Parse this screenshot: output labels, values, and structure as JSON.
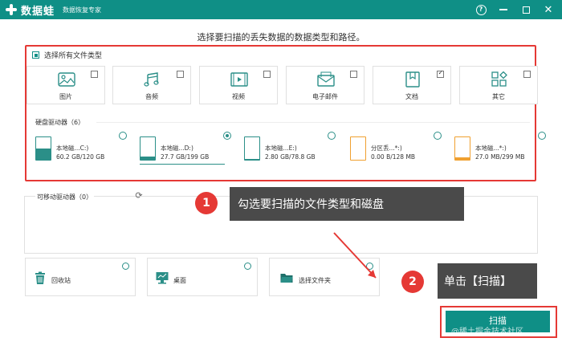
{
  "app": {
    "name": "数据蛙",
    "subtitle": "数据恢复专家",
    "help_icon": "help-icon",
    "accent": "#0f8f86"
  },
  "main": {
    "title": "选择要扫描的丢失数据的数据类型和路径。",
    "select_all": "选择所有文件类型",
    "file_types": [
      {
        "label": "图片",
        "checked": false,
        "icon": "image-icon"
      },
      {
        "label": "音频",
        "checked": false,
        "icon": "music-icon"
      },
      {
        "label": "视频",
        "checked": false,
        "icon": "video-icon"
      },
      {
        "label": "电子邮件",
        "checked": false,
        "icon": "email-icon"
      },
      {
        "label": "文档",
        "checked": true,
        "icon": "document-icon"
      },
      {
        "label": "其它",
        "checked": false,
        "icon": "other-icon"
      }
    ],
    "drives_label": "硬盘驱动器（6）",
    "drives": [
      {
        "name": "本地磁...C:)",
        "size": "60.2 GB/120 GB",
        "used_fraction": 0.5,
        "selected": false
      },
      {
        "name": "本地磁...D:)",
        "size": "27.7 GB/199 GB",
        "used_fraction": 0.14,
        "selected": true
      },
      {
        "name": "本地磁...E:)",
        "size": "2.80 GB/78.8 GB",
        "used_fraction": 0.04,
        "selected": false
      },
      {
        "name": "分区丢...*:)",
        "size": "0.00  B/128 MB",
        "used_fraction": 0.0,
        "selected": false
      },
      {
        "name": "本地磁...*:)",
        "size": "27.0 MB/299 MB",
        "used_fraction": 0.09,
        "selected": false
      }
    ],
    "removable_label": "可移动驱动器（0）",
    "quick_locations": [
      {
        "label": "回收站",
        "icon": "recycle-bin-icon"
      },
      {
        "label": "桌面",
        "icon": "desktop-icon"
      },
      {
        "label": "选择文件夹",
        "icon": "folder-icon"
      }
    ],
    "scan_label": "扫描"
  },
  "annotations": {
    "step1_number": "1",
    "step1_text": "勾选要扫描的文件类型和磁盘",
    "step2_number": "2",
    "step2_text": "单击【扫描】"
  },
  "watermark": "@稀土掘金技术社区"
}
